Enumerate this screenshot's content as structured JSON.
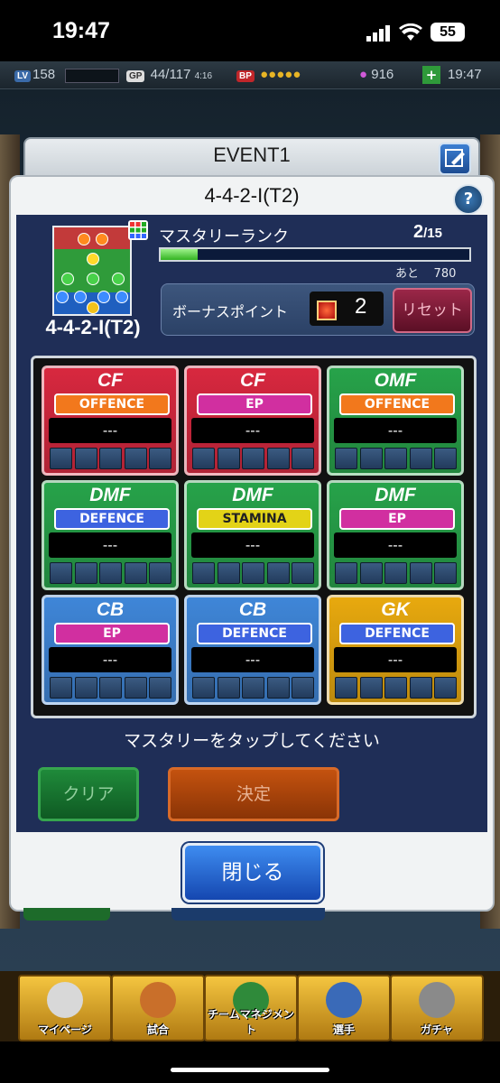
{
  "status": {
    "time": "19:47",
    "battery": "55"
  },
  "gamebar": {
    "lv_tag": "LV",
    "level": "158",
    "gp_tag": "GP",
    "gp": "44/117",
    "gp_timer": "4:16",
    "bp_tag": "BP",
    "coins": "916",
    "plus": "+",
    "time": "19:47"
  },
  "event": {
    "title": "EVENT1"
  },
  "modal": {
    "title": "4-4-2-I(T2)",
    "help": "?",
    "formation_name": "4-4-2-I(T2)",
    "mastery_label": "マスタリーランク",
    "mastery_rank": "2",
    "mastery_max": "/15",
    "mastery_progress": 0.12,
    "remaining_label": "あと",
    "remaining_value": "780",
    "bonus_label": "ボーナスポイント",
    "bonus_value": "2",
    "reset_label": "リセット",
    "hint": "マスタリーをタップしてください",
    "clear_label": "クリア",
    "decide_label": "決定",
    "close_label": "閉じる"
  },
  "cards": [
    {
      "pos": "CF",
      "type": "OFFENCE",
      "value": "---",
      "color": "#d8283f"
    },
    {
      "pos": "CF",
      "type": "EP",
      "value": "---",
      "color": "#d8283f"
    },
    {
      "pos": "OMF",
      "type": "OFFENCE",
      "value": "---",
      "color": "#27a34a"
    },
    {
      "pos": "DMF",
      "type": "DEFENCE",
      "value": "---",
      "color": "#27a34a"
    },
    {
      "pos": "DMF",
      "type": "STAMINA",
      "value": "---",
      "color": "#27a34a"
    },
    {
      "pos": "DMF",
      "type": "EP",
      "value": "---",
      "color": "#27a34a"
    },
    {
      "pos": "CB",
      "type": "EP",
      "value": "---",
      "color": "#3f86d8"
    },
    {
      "pos": "CB",
      "type": "DEFENCE",
      "value": "---",
      "color": "#3f86d8"
    },
    {
      "pos": "GK",
      "type": "DEFENCE",
      "value": "---",
      "color": "#e8a90e"
    }
  ],
  "type_colors": {
    "OFFENCE": "#f2781c",
    "EP": "#d12fa0",
    "DEFENCE": "#3d63e0",
    "STAMINA": "#e3d317"
  },
  "nav": [
    {
      "label": "マイページ",
      "icon": "mypage-icon"
    },
    {
      "label": "試合",
      "icon": "stadium-icon"
    },
    {
      "label": "チームマネジメント",
      "icon": "team-icon"
    },
    {
      "label": "選手",
      "icon": "player-icon"
    },
    {
      "label": "ガチャ",
      "icon": "gacha-icon"
    }
  ]
}
